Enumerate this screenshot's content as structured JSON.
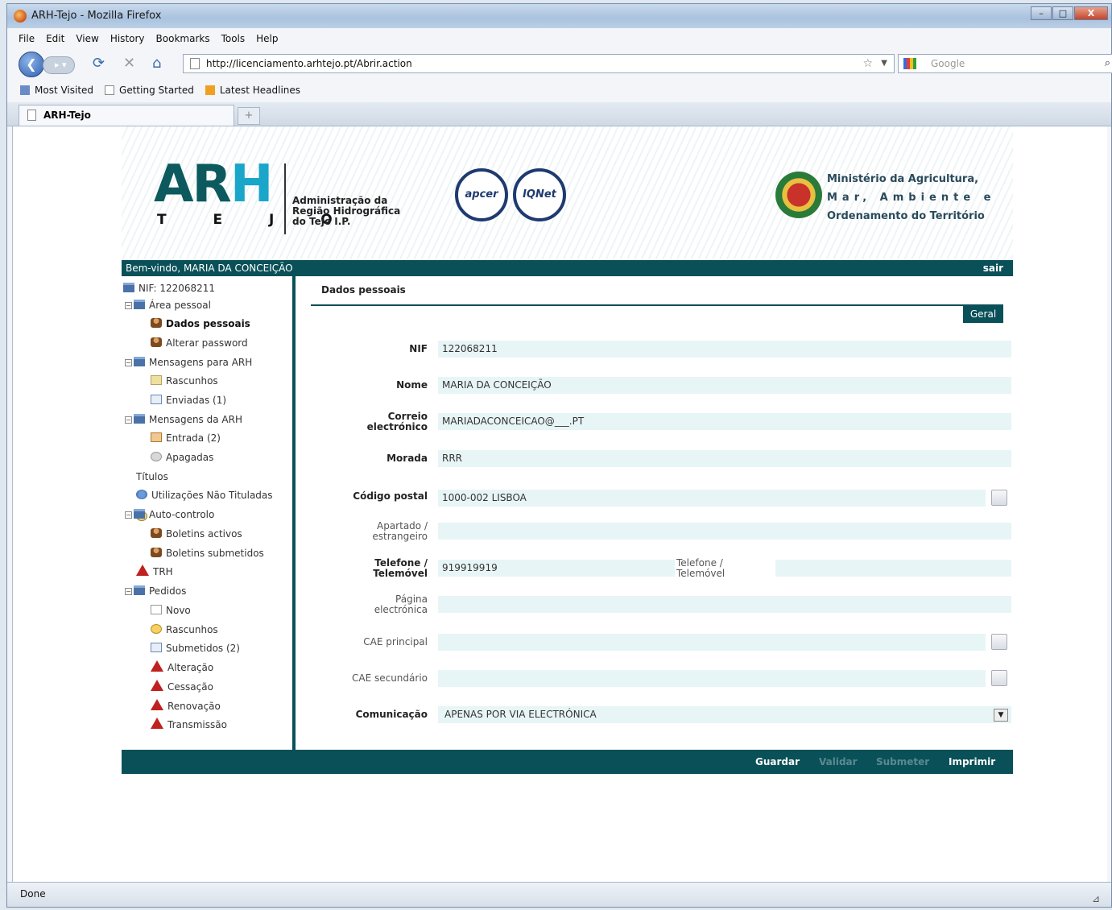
{
  "window": {
    "title": "ARH-Tejo - Mozilla Firefox",
    "buttons": [
      "–",
      "□",
      "X"
    ]
  },
  "menu": [
    "File",
    "Edit",
    "View",
    "History",
    "Bookmarks",
    "Tools",
    "Help"
  ],
  "nav": {
    "url": "http://licenciamento.arhtejo.pt/Abrir.action",
    "search_placeholder": "Google"
  },
  "bookmarks": [
    "Most Visited",
    "Getting Started",
    "Latest Headlines"
  ],
  "tab": {
    "label": "ARH-Tejo",
    "new_tab": "+"
  },
  "status": "Done",
  "header": {
    "logo_main": "AR",
    "logo_h": "H",
    "logo_sub": "T E J O",
    "org_lines": [
      "Administração da",
      "Região Hidrográfica",
      "do Tejo I.P."
    ],
    "cert1": "apcer",
    "cert2": "IQNet",
    "ministry_lines": [
      "Ministério da Agricultura,",
      "Mar, Ambiente e",
      "Ordenamento do Território"
    ]
  },
  "welcome": {
    "text": "Bem-vindo, MARIA DA CONCEIÇÃO",
    "logout": "sair"
  },
  "tree": [
    {
      "label": "NIF: 122068211"
    },
    {
      "label": "Área pessoal"
    },
    {
      "label": "Dados pessoais"
    },
    {
      "label": "Alterar password"
    },
    {
      "label": "Mensagens para ARH"
    },
    {
      "label": "Rascunhos"
    },
    {
      "label": "Enviadas (1)"
    },
    {
      "label": "Mensagens da ARH"
    },
    {
      "label": "Entrada (2)"
    },
    {
      "label": "Apagadas"
    },
    {
      "label": "Títulos"
    },
    {
      "label": "Utilizações Não Tituladas"
    },
    {
      "label": "Auto-controlo"
    },
    {
      "label": "Boletins activos"
    },
    {
      "label": "Boletins submetidos"
    },
    {
      "label": "TRH"
    },
    {
      "label": "Pedidos"
    },
    {
      "label": "Novo"
    },
    {
      "label": "Rascunhos"
    },
    {
      "label": "Submetidos (2)"
    },
    {
      "label": "Alteração"
    },
    {
      "label": "Cessação"
    },
    {
      "label": "Renovação"
    },
    {
      "label": "Transmissão"
    }
  ],
  "panel": {
    "title": "Dados pessoais",
    "tab": "Geral",
    "fields": {
      "nif": {
        "label": "NIF",
        "value": "122068211"
      },
      "nome": {
        "label": "Nome",
        "value": "MARIA DA CONCEIÇÃO"
      },
      "email": {
        "label1": "Correio",
        "label2": "electrónico",
        "value": "MARIADACONCEICAO@___.PT"
      },
      "morada": {
        "label": "Morada",
        "value": "RRR"
      },
      "codigo": {
        "label": "Código postal",
        "value": "1000-002 LISBOA"
      },
      "apartado": {
        "label1": "Apartado /",
        "label2": "estrangeiro",
        "value": ""
      },
      "telefone": {
        "label1": "Telefone /",
        "label2": "Telemóvel",
        "value": "919919919"
      },
      "telefone2": {
        "label1": "Telefone /",
        "label2": "Telemóvel",
        "value": ""
      },
      "pagina": {
        "label1": "Página",
        "label2": "electrónica",
        "value": ""
      },
      "cae1": {
        "label": "CAE principal",
        "value": ""
      },
      "cae2": {
        "label": "CAE secundário",
        "value": ""
      },
      "comunicacao": {
        "label": "Comunicação",
        "value": "APENAS POR VIA ELECTRÓNICA"
      }
    }
  },
  "footer": {
    "guardar": "Guardar",
    "validar": "Validar",
    "submeter": "Submeter",
    "imprimir": "Imprimir"
  }
}
